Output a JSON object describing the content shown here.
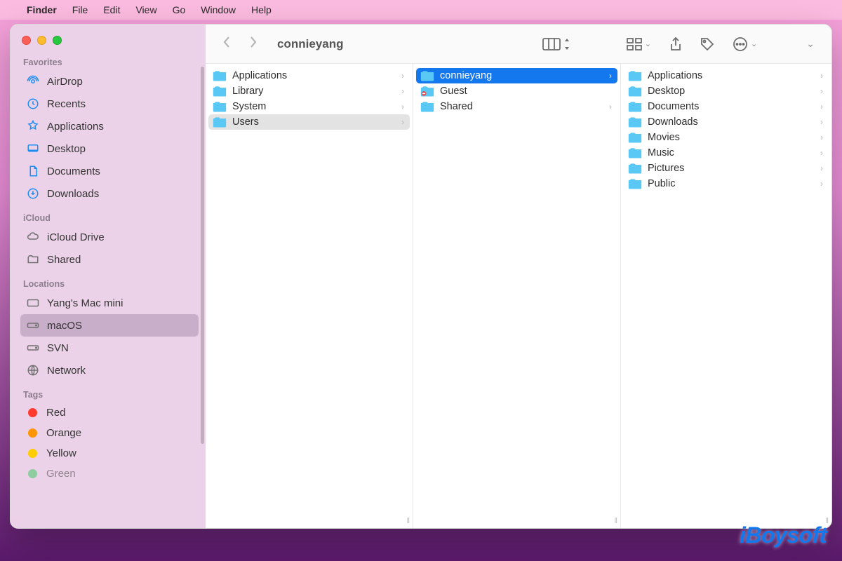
{
  "menubar": {
    "app": "Finder",
    "items": [
      "File",
      "Edit",
      "View",
      "Go",
      "Window",
      "Help"
    ]
  },
  "window": {
    "title": "connieyang"
  },
  "toolbar": {
    "icons": {
      "columns_view": "columns-view-icon",
      "grid": "grid-icon",
      "share": "share-icon",
      "tag": "tag-icon",
      "more": "more-icon"
    }
  },
  "sidebar": {
    "sections": [
      {
        "title": "Favorites",
        "items": [
          {
            "icon": "airdrop-icon",
            "label": "AirDrop"
          },
          {
            "icon": "recents-icon",
            "label": "Recents"
          },
          {
            "icon": "applications-icon",
            "label": "Applications"
          },
          {
            "icon": "desktop-icon",
            "label": "Desktop"
          },
          {
            "icon": "documents-icon",
            "label": "Documents"
          },
          {
            "icon": "downloads-icon",
            "label": "Downloads"
          }
        ]
      },
      {
        "title": "iCloud",
        "items": [
          {
            "icon": "icloud-icon",
            "label": "iCloud Drive"
          },
          {
            "icon": "shared-icon",
            "label": "Shared"
          }
        ]
      },
      {
        "title": "Locations",
        "items": [
          {
            "icon": "mac-icon",
            "label": "Yang's Mac mini"
          },
          {
            "icon": "drive-icon",
            "label": "macOS",
            "selected": true
          },
          {
            "icon": "drive-icon",
            "label": "SVN"
          },
          {
            "icon": "network-icon",
            "label": "Network"
          }
        ]
      },
      {
        "title": "Tags",
        "items": [
          {
            "tagColor": "#ff3b30",
            "label": "Red"
          },
          {
            "tagColor": "#ff9500",
            "label": "Orange"
          },
          {
            "tagColor": "#ffcc00",
            "label": "Yellow"
          },
          {
            "tagColor": "#34c759",
            "label": "Green"
          }
        ]
      }
    ]
  },
  "columns": [
    {
      "items": [
        {
          "label": "Applications",
          "hasChildren": true
        },
        {
          "label": "Library",
          "hasChildren": true
        },
        {
          "label": "System",
          "hasChildren": true
        },
        {
          "label": "Users",
          "hasChildren": true,
          "selected": "light"
        }
      ]
    },
    {
      "items": [
        {
          "label": "connieyang",
          "hasChildren": true,
          "selected": "blue"
        },
        {
          "label": "Guest",
          "hasChildren": false,
          "iconVariant": "guest"
        },
        {
          "label": "Shared",
          "hasChildren": true
        }
      ]
    },
    {
      "items": [
        {
          "label": "Applications",
          "hasChildren": true
        },
        {
          "label": "Desktop",
          "hasChildren": true
        },
        {
          "label": "Documents",
          "hasChildren": true
        },
        {
          "label": "Downloads",
          "hasChildren": true
        },
        {
          "label": "Movies",
          "hasChildren": true
        },
        {
          "label": "Music",
          "hasChildren": true
        },
        {
          "label": "Pictures",
          "hasChildren": true
        },
        {
          "label": "Public",
          "hasChildren": true
        }
      ]
    }
  ],
  "watermark": "iBoysoft"
}
